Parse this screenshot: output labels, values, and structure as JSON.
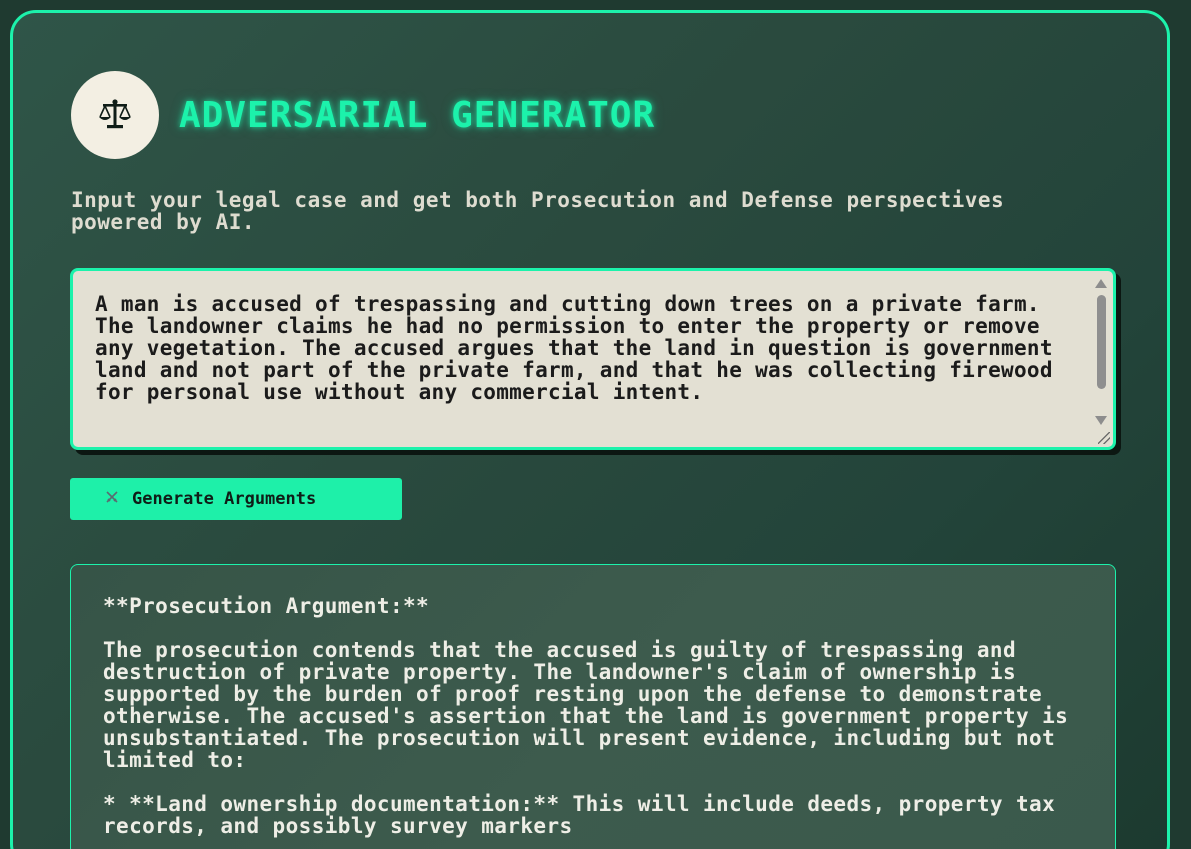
{
  "header": {
    "logo_icon": "scales-of-justice-icon",
    "title": "ADVERSARIAL GENERATOR"
  },
  "subtitle": "Input your legal case and get both Prosecution and Defense perspectives powered by AI.",
  "case_input": {
    "value": "A man is accused of trespassing and cutting down trees on a private farm. The landowner claims he had no permission to enter the property or remove any vegetation. The accused argues that the land in question is government land and not part of the private farm, and that he was collecting firewood for personal use without any commercial intent."
  },
  "generate_button": {
    "icon": "crossed-swords-icon",
    "label": "Generate Arguments"
  },
  "result": {
    "heading": "**Prosecution Argument:**",
    "paragraph": "The prosecution contends that the accused is guilty of trespassing and destruction of private property. The landowner's claim of ownership is supported by the burden of proof resting upon the defense to demonstrate otherwise. The accused's assertion that the land is government property is unsubstantiated. The prosecution will present evidence, including but not limited to:",
    "bullet_1": "* **Land ownership documentation:** This will include deeds, property tax records, and possibly survey markers"
  },
  "colors": {
    "accent": "#1cf2ab",
    "background": "#2a4a3e",
    "textarea_bg": "#e3e0d3",
    "text_light": "#eeeee6"
  }
}
